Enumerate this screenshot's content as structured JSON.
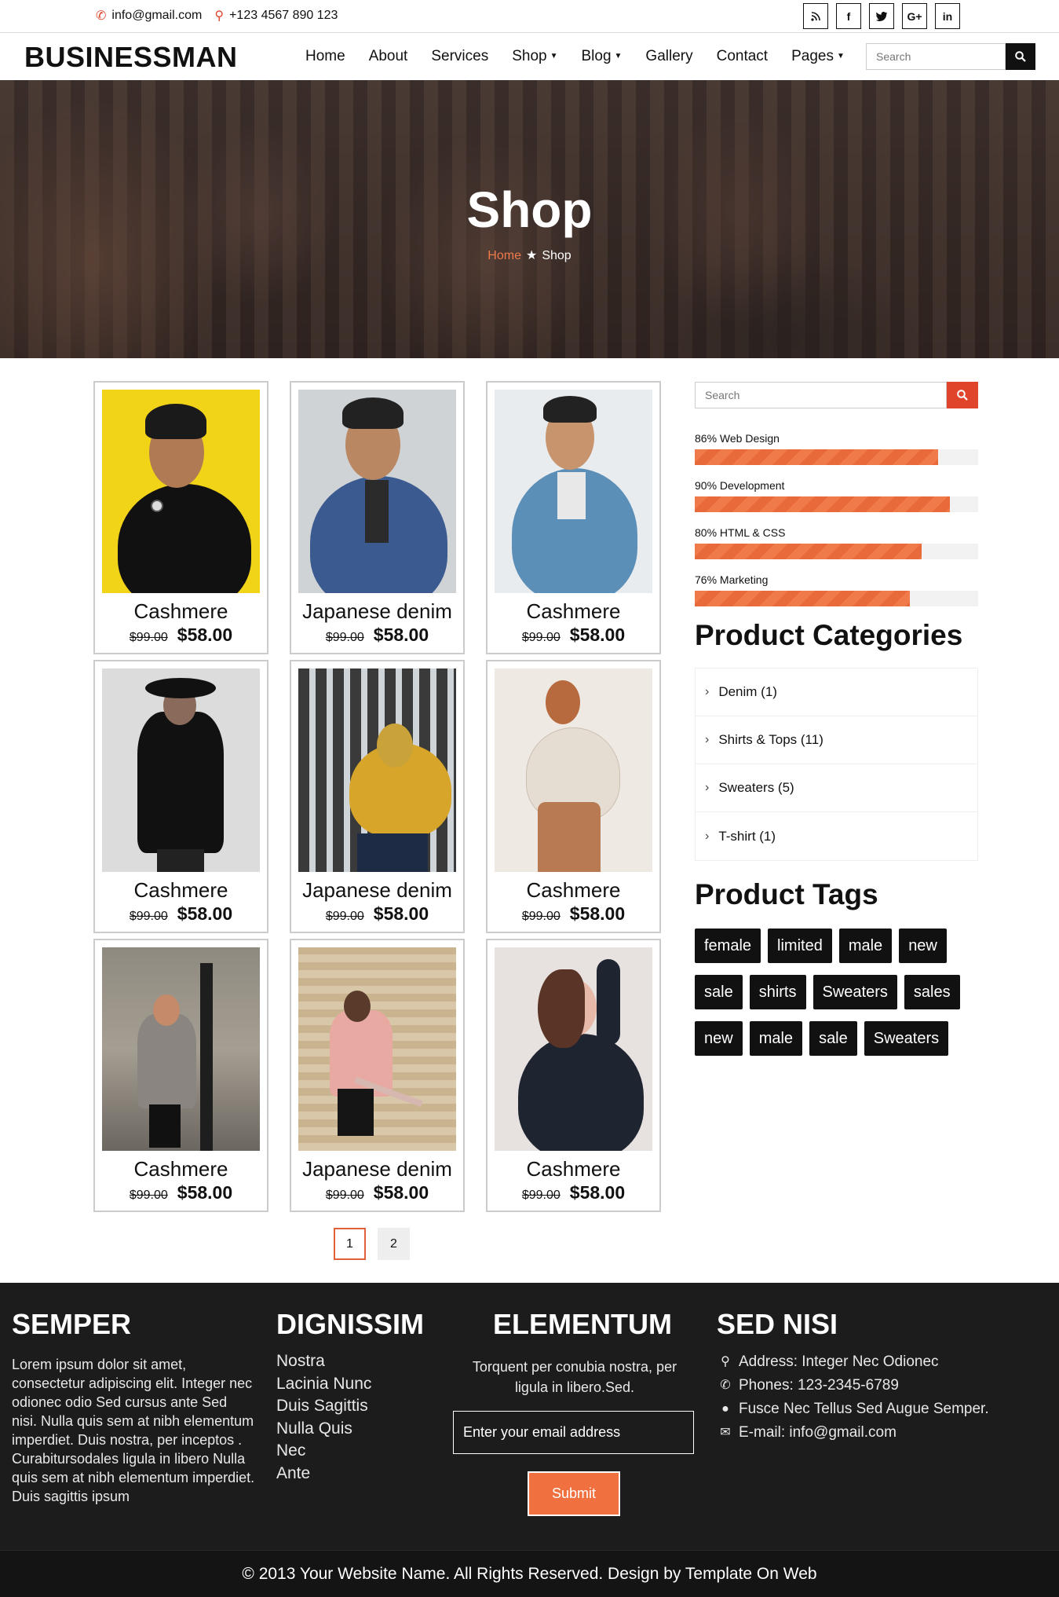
{
  "topbar": {
    "email": "info@gmail.com",
    "phone": "+123 4567 890 123",
    "socials": [
      "rss",
      "f",
      "t",
      "G+",
      "in"
    ]
  },
  "header": {
    "logo": "BUSINESSMAN",
    "nav": [
      {
        "label": "Home",
        "dropdown": false
      },
      {
        "label": "About",
        "dropdown": false
      },
      {
        "label": "Services",
        "dropdown": false
      },
      {
        "label": "Shop",
        "dropdown": true
      },
      {
        "label": "Blog",
        "dropdown": true
      },
      {
        "label": "Gallery",
        "dropdown": false
      },
      {
        "label": "Contact",
        "dropdown": false
      },
      {
        "label": "Pages",
        "dropdown": true
      }
    ],
    "search_placeholder": "Search"
  },
  "hero": {
    "title": "Shop",
    "breadcrumb_home": "Home",
    "breadcrumb_current": "Shop"
  },
  "products": [
    {
      "name": "Cashmere",
      "old_price": "$99.00",
      "price": "$58.00"
    },
    {
      "name": "Japanese denim",
      "old_price": "$99.00",
      "price": "$58.00"
    },
    {
      "name": "Cashmere",
      "old_price": "$99.00",
      "price": "$58.00"
    },
    {
      "name": "Cashmere",
      "old_price": "$99.00",
      "price": "$58.00"
    },
    {
      "name": "Japanese denim",
      "old_price": "$99.00",
      "price": "$58.00"
    },
    {
      "name": "Cashmere",
      "old_price": "$99.00",
      "price": "$58.00"
    },
    {
      "name": "Cashmere",
      "old_price": "$99.00",
      "price": "$58.00"
    },
    {
      "name": "Japanese denim",
      "old_price": "$99.00",
      "price": "$58.00"
    },
    {
      "name": "Cashmere",
      "old_price": "$99.00",
      "price": "$58.00"
    }
  ],
  "pagination": [
    "1",
    "2"
  ],
  "sidebar": {
    "search_placeholder": "Search",
    "skills": [
      {
        "label": "86% Web Design",
        "value": 86
      },
      {
        "label": "90% Development",
        "value": 90
      },
      {
        "label": "80% HTML & CSS",
        "value": 80
      },
      {
        "label": "76% Marketing",
        "value": 76
      }
    ],
    "categories_title": "Product Categories",
    "categories": [
      "Denim (1)",
      "Shirts & Tops (11)",
      "Sweaters (5)",
      "T-shirt (1)"
    ],
    "tags_title": "Product Tags",
    "tags": [
      [
        "female",
        "limited",
        "male",
        "new"
      ],
      [
        "sale",
        "shirts",
        "Sweaters",
        "sales"
      ],
      [
        "new",
        "male",
        "sale",
        "Sweaters"
      ]
    ]
  },
  "footer": {
    "col1_title": "SEMPER",
    "col1_text": "Lorem ipsum dolor sit amet, consectetur adipiscing elit. Integer nec odionec odio Sed cursus ante Sed nisi. Nulla quis sem at nibh elementum imperdiet. Duis nostra, per inceptos . Curabitursodales ligula in libero Nulla quis sem at nibh elementum imperdiet. Duis sagittis ipsum",
    "col2_title": "DIGNISSIM",
    "col2_links": [
      "Nostra",
      "Lacinia Nunc",
      "Duis Sagittis",
      "Nulla Quis",
      "Nec",
      "Ante"
    ],
    "col3_title": "ELEMENTUM",
    "col3_text": "Torquent per conubia nostra, per ligula in libero.Sed.",
    "email_placeholder": "Enter your email address",
    "submit_label": "Submit",
    "col4_title": "SED NISI",
    "address": "Address: Integer Nec Odionec",
    "phones": "Phones: 123-2345-6789",
    "person": "Fusce Nec Tellus Sed Augue Semper.",
    "email": "E-mail: info@gmail.com",
    "copyright": "© 2013 Your Website Name. All Rights Reserved. Design by Template On Web"
  },
  "colors": {
    "accent": "#f07a4a",
    "search_button": "#e0452c",
    "footer_bg": "#1c1c1c",
    "tag_bg": "#111111"
  }
}
